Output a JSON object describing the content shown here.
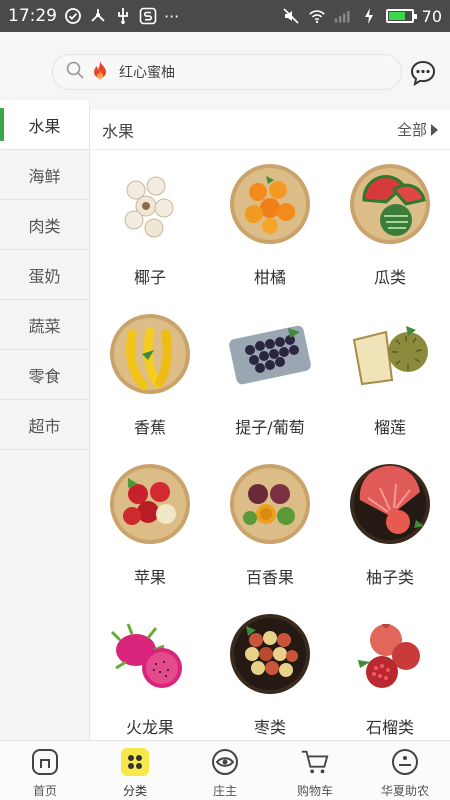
{
  "status_bar": {
    "time": "17:29",
    "more": "···",
    "battery_level": "70",
    "battery_fraction": 0.7
  },
  "search": {
    "placeholder": "红心蜜柚"
  },
  "sidebar": {
    "items": [
      {
        "label": "水果",
        "active": true
      },
      {
        "label": "海鲜",
        "active": false
      },
      {
        "label": "肉类",
        "active": false
      },
      {
        "label": "蛋奶",
        "active": false
      },
      {
        "label": "蔬菜",
        "active": false
      },
      {
        "label": "零食",
        "active": false
      },
      {
        "label": "超市",
        "active": false
      }
    ]
  },
  "main": {
    "title": "水果",
    "all_label": "全部",
    "products": [
      {
        "label": "椰子",
        "icon": "coconut-icon"
      },
      {
        "label": "柑橘",
        "icon": "orange-icon"
      },
      {
        "label": "瓜类",
        "icon": "melon-icon"
      },
      {
        "label": "香蕉",
        "icon": "banana-icon"
      },
      {
        "label": "提子/葡萄",
        "icon": "grape-icon"
      },
      {
        "label": "榴莲",
        "icon": "durian-icon"
      },
      {
        "label": "苹果",
        "icon": "apple-icon"
      },
      {
        "label": "百香果",
        "icon": "passion-fruit-icon"
      },
      {
        "label": "柚子类",
        "icon": "pomelo-icon"
      },
      {
        "label": "火龙果",
        "icon": "dragon-fruit-icon"
      },
      {
        "label": "枣类",
        "icon": "jujube-icon"
      },
      {
        "label": "石榴类",
        "icon": "pomegranate-icon"
      }
    ]
  },
  "tabbar": {
    "tabs": [
      {
        "label": "首页",
        "icon": "home-icon"
      },
      {
        "label": "分类",
        "icon": "category-icon",
        "active": true
      },
      {
        "label": "庄主",
        "icon": "eye-icon"
      },
      {
        "label": "购物车",
        "icon": "cart-icon"
      },
      {
        "label": "华夏助农",
        "icon": "smile-icon"
      }
    ]
  },
  "colors": {
    "accent_green": "#3aa848",
    "category_yellow": "#f7e84a",
    "status_bar": "#4a4a4a"
  }
}
